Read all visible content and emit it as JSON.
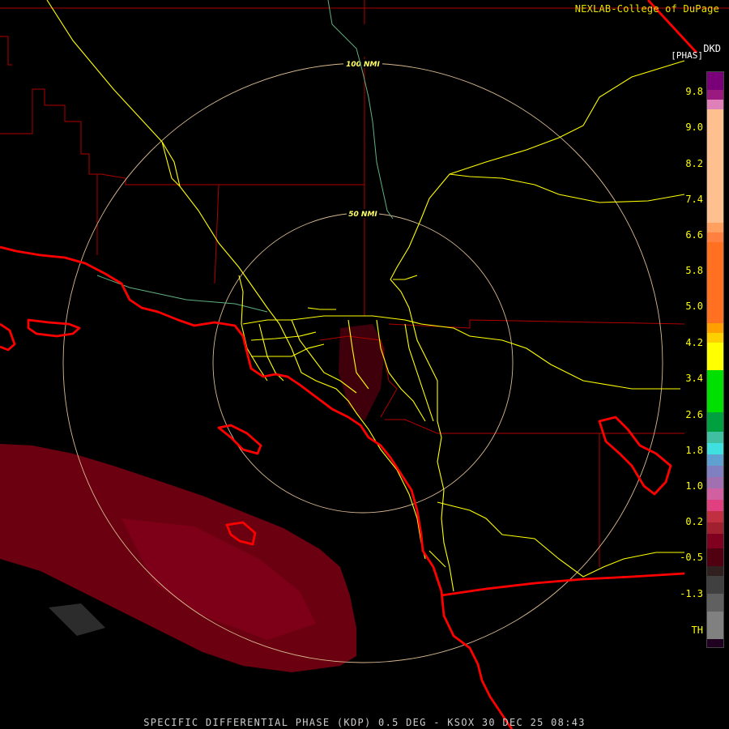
{
  "credit": "NEXLAB-College of DuPage",
  "product": {
    "code": "DKD",
    "units": "[PHAS]"
  },
  "footer": "SPECIFIC DIFFERENTIAL PHASE (KDP) 0.5 DEG - KSOX 30 DEC 25 08:43",
  "range_rings": [
    {
      "label": "100 NMI"
    },
    {
      "label": "50 NMI"
    }
  ],
  "colorbar": {
    "labels": [
      "9.8",
      "9.0",
      "8.2",
      "7.4",
      "6.6",
      "5.8",
      "5.0",
      "4.2",
      "3.4",
      "2.6",
      "1.8",
      "1.0",
      "0.2",
      "-0.5",
      "-1.3",
      "TH"
    ]
  },
  "colors": {
    "state_borders": "#ff0000",
    "county_lines": "#b00000",
    "highways": "#ffff00",
    "rings": "#d8b890",
    "low_kdp_echo": "#6a0010"
  }
}
